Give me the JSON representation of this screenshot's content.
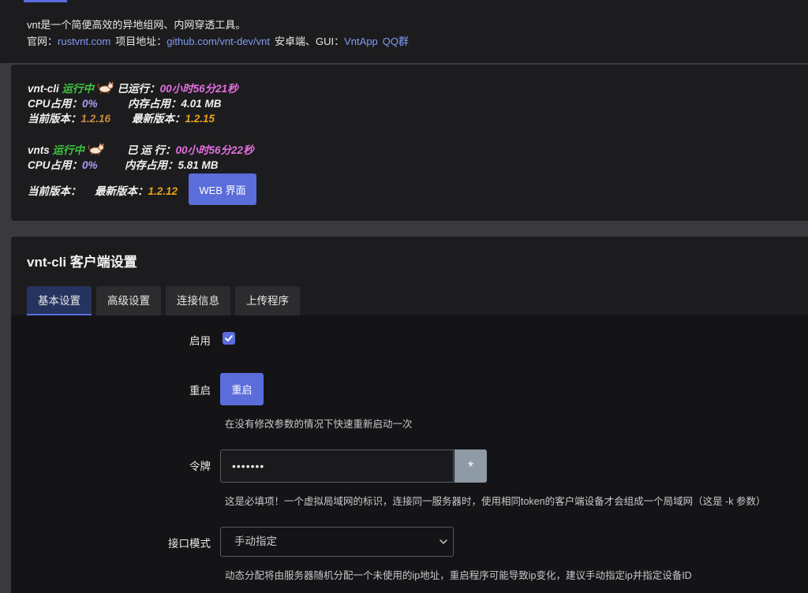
{
  "intro": {
    "line1": "vnt是一个简便高效的异地组网、内网穿透工具。",
    "site_label": "官网：",
    "site_link": "rustvnt.com",
    "project_label": "项目地址：",
    "project_link": "github.com/vnt-dev/vnt",
    "android_label": "安卓端、GUI：",
    "vntapp_link": "VntApp",
    "qq_link": "QQ群"
  },
  "status": {
    "cli": {
      "name": "vnt-cli",
      "state": "运行中",
      "uptime_label": "已运行：",
      "uptime_value": "00小时56分21秒",
      "cpu_label": "CPU占用：",
      "cpu_value": "0%",
      "mem_label": "内存占用：",
      "mem_value": "4.01 MB",
      "cur_ver_label": "当前版本：",
      "cur_ver_value": "1.2.16",
      "latest_ver_label": "最新版本：",
      "latest_ver_value": "1.2.15"
    },
    "vnts": {
      "name": "vnts",
      "state": "运行中",
      "uptime_label": "已 运 行：",
      "uptime_value": "00小时56分22秒",
      "cpu_label": "CPU占用：",
      "cpu_value": "0%",
      "mem_label": "内存占用：",
      "mem_value": "5.81 MB",
      "cur_ver_label": "当前版本：",
      "latest_ver_label": "最新版本：",
      "latest_ver_value": "1.2.12",
      "web_button": "WEB 界面"
    }
  },
  "settings": {
    "title": "vnt-cli 客户端设置",
    "tabs": [
      {
        "label": "基本设置"
      },
      {
        "label": "高级设置"
      },
      {
        "label": "连接信息"
      },
      {
        "label": "上传程序"
      }
    ],
    "enable_label": "启用",
    "enable_checked": true,
    "restart_label": "重启",
    "restart_button": "重启",
    "restart_hint": "在没有修改参数的情况下快速重新启动一次",
    "token_label": "令牌",
    "token_value": "•••••••",
    "reveal_button": "*",
    "token_hint": "这是必填项！一个虚拟局域网的标识，连接同一服务器时，使用相同token的客户端设备才会组成一个局域网（这是 -k 参数）",
    "mode_label": "接口模式",
    "mode_value": "手动指定",
    "mode_hint": "动态分配将由服务器随机分配一个未使用的ip地址，重启程序可能导致ip变化，建议手动指定ip并指定设备ID"
  },
  "colors": {
    "accent": "#5b6cdb",
    "running": "#3ec63e",
    "uptime": "#e46fe0",
    "version_latest": "#e8a11a"
  }
}
